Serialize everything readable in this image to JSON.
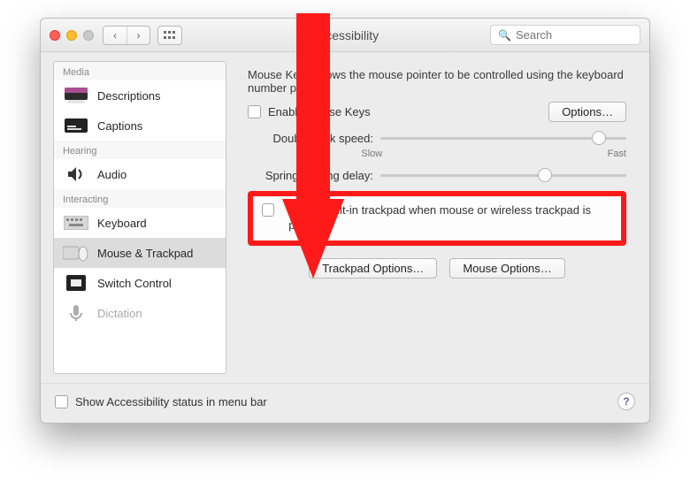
{
  "window": {
    "title": "Accessibility"
  },
  "search": {
    "placeholder": "Search",
    "value": ""
  },
  "sidebar": {
    "sections": [
      {
        "label": "Media",
        "items": [
          {
            "label": "Descriptions"
          },
          {
            "label": "Captions"
          }
        ]
      },
      {
        "label": "Hearing",
        "items": [
          {
            "label": "Audio"
          }
        ]
      },
      {
        "label": "Interacting",
        "items": [
          {
            "label": "Keyboard"
          },
          {
            "label": "Mouse & Trackpad",
            "selected": true
          },
          {
            "label": "Switch Control"
          },
          {
            "label": "Dictation"
          }
        ]
      }
    ]
  },
  "pane": {
    "intro": "Mouse Keys allows the mouse pointer to be controlled using the keyboard number pad.",
    "enable_mouse_keys_label": "Enable Mouse Keys",
    "options_button": "Options…",
    "dbl_click_label": "Double-click speed:",
    "spring_label": "Spring-loading delay:",
    "slow": "Slow",
    "fast": "Fast",
    "ignore_label": "Ignore built-in trackpad when mouse or wireless trackpad is present",
    "trackpad_options": "Trackpad Options…",
    "mouse_options": "Mouse Options…"
  },
  "footer": {
    "status_label": "Show Accessibility status in menu bar"
  }
}
